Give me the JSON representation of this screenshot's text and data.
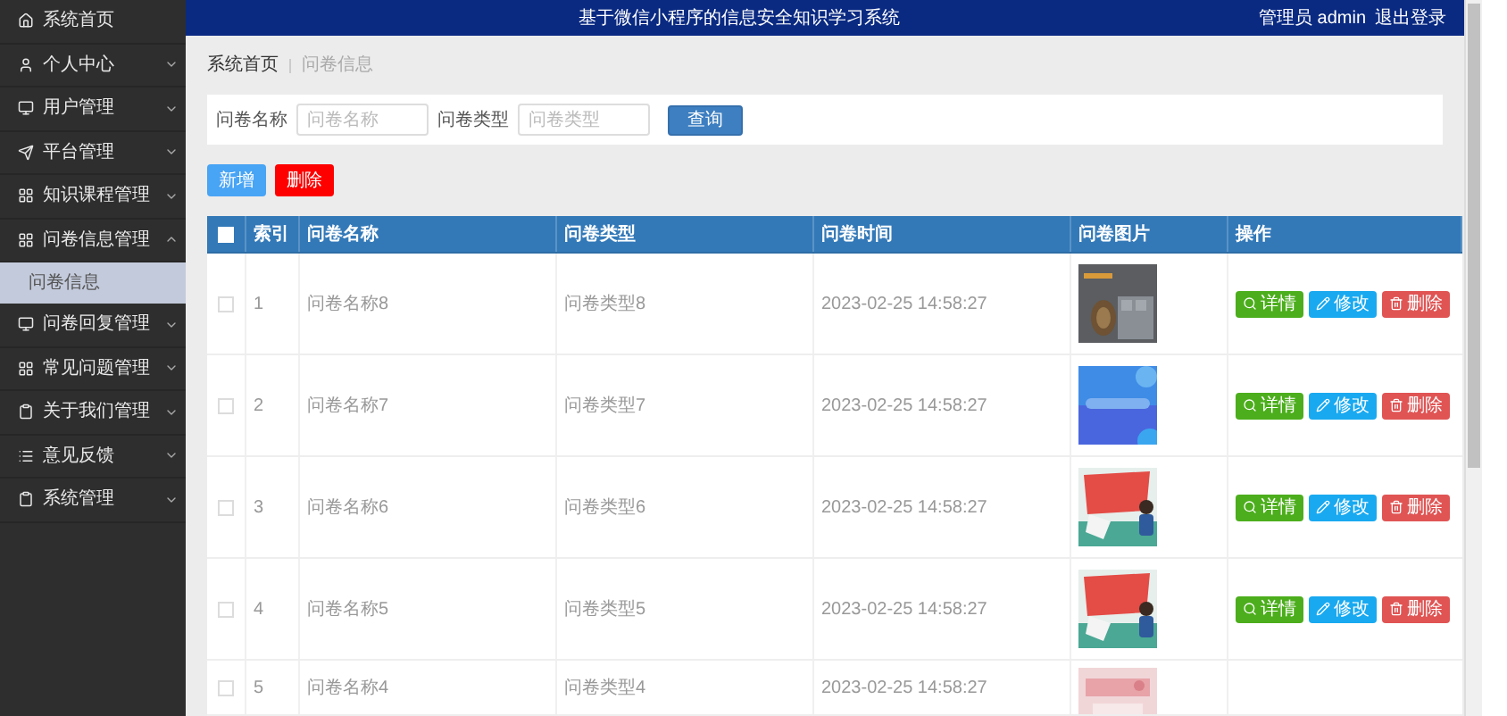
{
  "header": {
    "title": "基于微信小程序的信息安全知识学习系统",
    "user": "管理员 admin",
    "logout": "退出登录"
  },
  "sidebar": {
    "items": [
      {
        "label": "系统首页",
        "kind": "link"
      },
      {
        "label": "个人中心",
        "kind": "menu",
        "expanded": false
      },
      {
        "label": "用户管理",
        "kind": "menu",
        "expanded": false
      },
      {
        "label": "平台管理",
        "kind": "menu",
        "expanded": false
      },
      {
        "label": "知识课程管理",
        "kind": "menu",
        "expanded": false
      },
      {
        "label": "问卷信息管理",
        "kind": "menu",
        "expanded": true,
        "children": [
          {
            "label": "问卷信息",
            "selected": true
          }
        ]
      },
      {
        "label": "问卷回复管理",
        "kind": "menu",
        "expanded": false
      },
      {
        "label": "常见问题管理",
        "kind": "menu",
        "expanded": false
      },
      {
        "label": "关于我们管理",
        "kind": "menu",
        "expanded": false
      },
      {
        "label": "意见反馈",
        "kind": "menu",
        "expanded": false
      },
      {
        "label": "系统管理",
        "kind": "menu",
        "expanded": false
      }
    ]
  },
  "breadcrumb": [
    "系统首页",
    "问卷信息"
  ],
  "search": {
    "fields": [
      {
        "label": "问卷名称",
        "placeholder": "问卷名称"
      },
      {
        "label": "问卷类型",
        "placeholder": "问卷类型"
      }
    ],
    "button": "查询"
  },
  "actions": [
    {
      "label": "新增",
      "kind": "add"
    },
    {
      "label": "删除",
      "kind": "delete"
    }
  ],
  "table": {
    "select_all": {
      "checked": false
    },
    "columns": [
      "索引",
      "问卷名称",
      "问卷类型",
      "问卷时间",
      "问卷图片",
      "操作"
    ],
    "rows": [
      {
        "checked": false,
        "index": "1",
        "name": "问卷名称8",
        "type": "问卷类型8",
        "time": "2023-02-25 14:58:27",
        "actions": [
          {
            "label": "详情",
            "kind": "detail"
          },
          {
            "label": "修改",
            "kind": "edit"
          },
          {
            "label": "删除",
            "kind": "delete"
          }
        ]
      },
      {
        "checked": false,
        "index": "2",
        "name": "问卷名称7",
        "type": "问卷类型7",
        "time": "2023-02-25 14:58:27",
        "actions": [
          {
            "label": "详情",
            "kind": "detail"
          },
          {
            "label": "修改",
            "kind": "edit"
          },
          {
            "label": "删除",
            "kind": "delete"
          }
        ]
      },
      {
        "checked": false,
        "index": "3",
        "name": "问卷名称6",
        "type": "问卷类型6",
        "time": "2023-02-25 14:58:27",
        "actions": [
          {
            "label": "详情",
            "kind": "detail"
          },
          {
            "label": "修改",
            "kind": "edit"
          },
          {
            "label": "删除",
            "kind": "delete"
          }
        ]
      },
      {
        "checked": false,
        "index": "4",
        "name": "问卷名称5",
        "type": "问卷类型5",
        "time": "2023-02-25 14:58:27",
        "actions": [
          {
            "label": "详情",
            "kind": "detail"
          },
          {
            "label": "修改",
            "kind": "edit"
          },
          {
            "label": "删除",
            "kind": "delete"
          }
        ]
      },
      {
        "checked": false,
        "index": "5",
        "name": "问卷名称4",
        "type": "问卷类型4",
        "time": "2023-02-25 14:58:27"
      }
    ]
  }
}
